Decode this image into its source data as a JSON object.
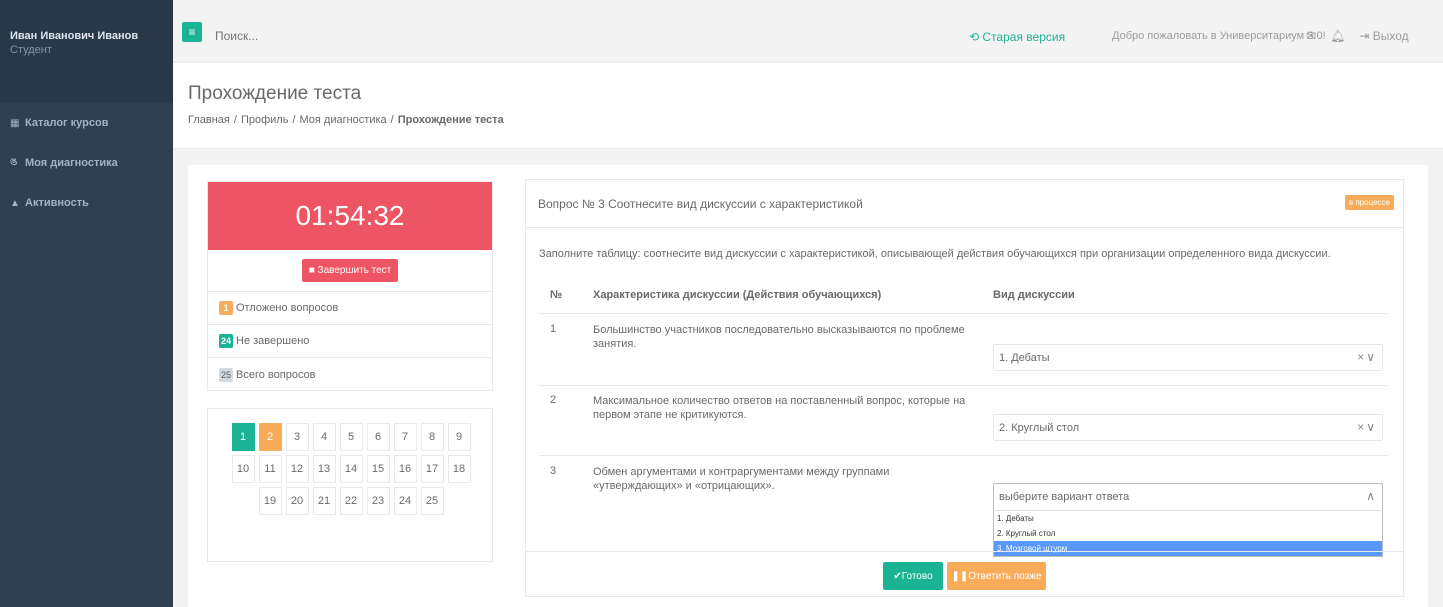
{
  "user": {
    "name": "Иван Иванович Иванов",
    "role": "Студент"
  },
  "sidebar": {
    "items": [
      {
        "label": "Каталог курсов",
        "icon": "th-large-icon"
      },
      {
        "label": "Моя диагностика",
        "icon": "stethoscope-icon"
      },
      {
        "label": "Активность",
        "icon": "flask-icon"
      }
    ]
  },
  "topbar": {
    "menu_glyph": "≡",
    "search_placeholder": "Поиск...",
    "old_version": "Старая версия",
    "welcome": "Добро пожаловать в Университариум 3.0!",
    "logout": "Выход"
  },
  "page": {
    "title": "Прохождение теста",
    "breadcrumb": [
      "Главная",
      "Профиль",
      "Моя диагностика",
      "Прохождение теста"
    ]
  },
  "timer": {
    "value": "01:54:32",
    "finish_label": "Завершить тест"
  },
  "stats": [
    {
      "count": "1",
      "label": "Отложено вопросов",
      "color": "#f8ac59"
    },
    {
      "count": "24",
      "label": "Не завершено",
      "color": "#1ab394"
    },
    {
      "count": "25",
      "label": "Всего вопросов",
      "color": "#d1dade"
    }
  ],
  "question_nav": {
    "numbers": [
      "1",
      "2",
      "3",
      "4",
      "5",
      "6",
      "7",
      "8",
      "9",
      "10",
      "11",
      "12",
      "13",
      "14",
      "15",
      "16",
      "17",
      "18",
      "19",
      "20",
      "21",
      "22",
      "23",
      "24",
      "25"
    ],
    "done": [
      "1"
    ],
    "postponed": [
      "2"
    ]
  },
  "question": {
    "title": "Вопрос № 3 Соотнесите вид дискуссии с характеристикой",
    "status": "в процессе",
    "instructions": "Заполните таблицу: соотнесите вид дискуссии с характеристикой, описывающей действия обучающихся при организации определенного вида дискуссии.",
    "headers": {
      "num": "№",
      "characteristic": "Характеристика дискуссии (Действия обучающихся)",
      "kind": "Вид дискуссии"
    },
    "rows": [
      {
        "num": "1",
        "text": "Большинство участников последовательно высказываются по проблеме занятия.",
        "selected": "1. Дебаты"
      },
      {
        "num": "2",
        "text": "Максимальное количество ответов на поставленный вопрос, которые на первом этапе не критикуются.",
        "selected": "2. Круглый стол"
      },
      {
        "num": "3",
        "text": "Обмен аргументами и контраргументами между группами «утверждающих» и «отрицающих».",
        "selected": "",
        "placeholder": "выберите вариант ответа"
      }
    ],
    "options": [
      "1. Дебаты",
      "2. Круглый стол",
      "3. Мозговой штурм"
    ],
    "highlighted_option": "3. Мозговой штурм",
    "ready_label": "Готово",
    "later_label": "Ответить позже"
  },
  "colors": {
    "accent": "#1ab394",
    "danger": "#ed5565",
    "warning": "#f8ac59",
    "sidebar": "#2f4050"
  }
}
